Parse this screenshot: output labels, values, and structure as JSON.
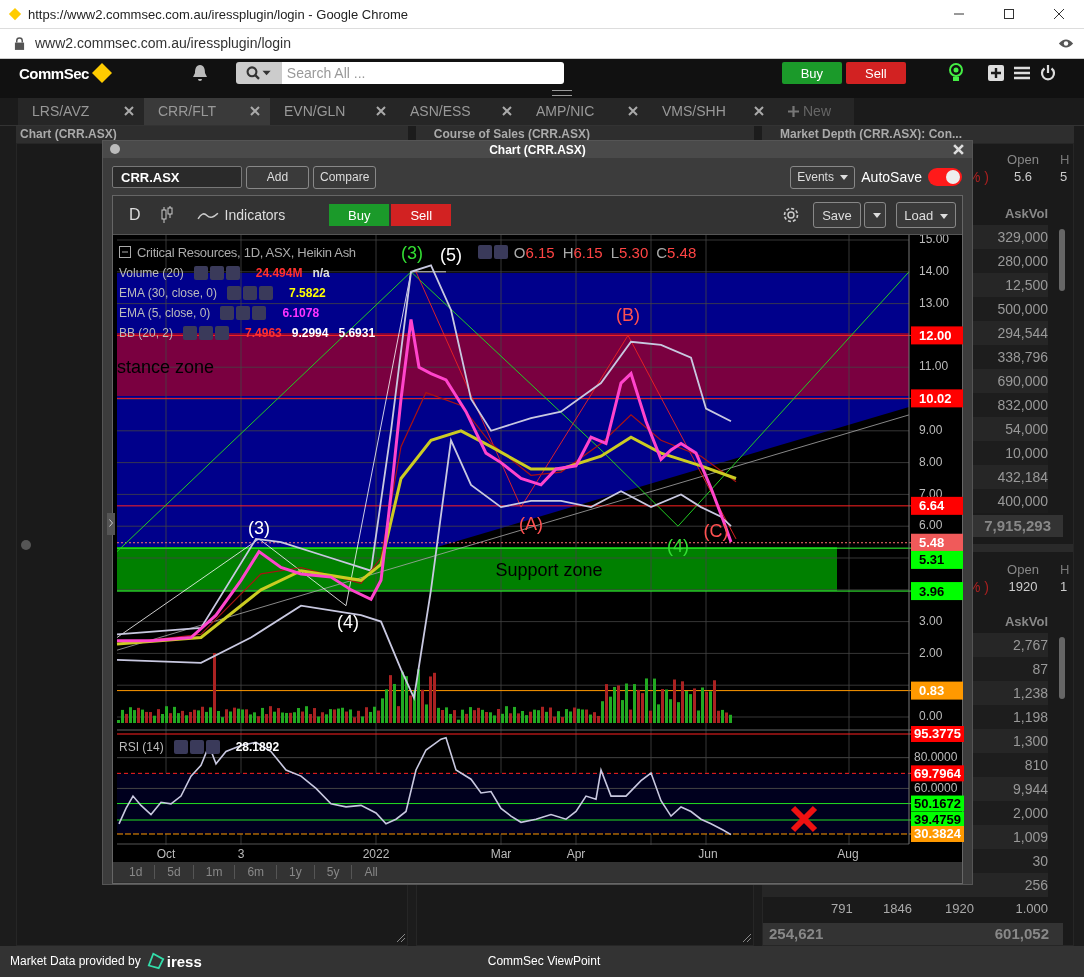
{
  "browser": {
    "title": "https://www2.commsec.com.au/iressplugin/login - Google Chrome",
    "url": "www2.commsec.com.au/iressplugin/login"
  },
  "header": {
    "logo": "CommSec",
    "search_placeholder": "Search All ...",
    "buy": "Buy",
    "sell": "Sell"
  },
  "tabs": [
    {
      "label": "LRS/AVZ",
      "selected": false
    },
    {
      "label": "CRR/FLT",
      "selected": true
    },
    {
      "label": "EVN/GLN",
      "selected": false
    },
    {
      "label": "ASN/ESS",
      "selected": false
    },
    {
      "label": "AMP/NIC",
      "selected": false
    },
    {
      "label": "VMS/SHH",
      "selected": false
    }
  ],
  "new_tab": "New",
  "panels": {
    "chart": "Chart (CRR.ASX)",
    "course_of_sales": "Course of Sales (CRR.ASX)",
    "market_depth": "Market Depth (CRR.ASX): Con..."
  },
  "depth": [
    {
      "open_label": "Open",
      "open": "5.6",
      "h_label": "H",
      "h": "5",
      "change": "% )",
      "ask_vol_label": "AskVol",
      "ask_vols": [
        "329,000",
        "280,000",
        "12,500",
        "500,000",
        "294,544",
        "338,796",
        "690,000",
        "832,000",
        "54,000",
        "10,000",
        "432,184",
        "400,000"
      ],
      "totals": [
        "7,915,293"
      ]
    },
    {
      "open_label": "Open",
      "open": "1920",
      "h_label": "H",
      "h": "1",
      "change": "% )",
      "ask_vol_label": "AskVol",
      "ask_vols": [
        "2,767",
        "87",
        "1,238",
        "1,198",
        "1,300",
        "810",
        "9,944",
        "2,000",
        "1,009",
        "30",
        "256"
      ],
      "footer": [
        "791",
        "1846",
        "1920",
        "1.000"
      ],
      "totals": [
        "254,621",
        "601,052"
      ]
    }
  ],
  "chart_window": {
    "title": "Chart (CRR.ASX)",
    "symbol": "CRR.ASX",
    "add": "Add",
    "compare": "Compare",
    "events": "Events",
    "autosave_label": "AutoSave",
    "autosave_on": true,
    "interval": "D",
    "indicators": "Indicators",
    "buy": "Buy",
    "sell": "Sell",
    "save": "Save",
    "load": "Load",
    "legend": {
      "title": "Critical Resources, 1D, ASX, Heikin Ash",
      "ohlc": [
        {
          "label": "O",
          "value": "6.15"
        },
        {
          "label": "H",
          "value": "6.15"
        },
        {
          "label": "L",
          "value": "5.30"
        },
        {
          "label": "C",
          "value": "5.48"
        }
      ]
    },
    "studies": [
      {
        "name": "Volume (20)",
        "values": [
          {
            "text": "24.494M",
            "color": "#ff3030"
          },
          {
            "text": "n/a",
            "color": "#dddddd"
          }
        ]
      },
      {
        "name": "EMA (30, close, 0)",
        "values": [
          {
            "text": "7.5822",
            "color": "#ffff00"
          }
        ]
      },
      {
        "name": "EMA (5, close, 0)",
        "values": [
          {
            "text": "6.1078",
            "color": "#ff33ff"
          }
        ]
      },
      {
        "name": "BB (20, 2)",
        "values": [
          {
            "text": "7.4963",
            "color": "#ff3030"
          },
          {
            "text": "9.2994",
            "color": "#ffffff"
          },
          {
            "text": "5.6931",
            "color": "#ffffff"
          }
        ]
      }
    ],
    "price_ticks": [
      "15.00",
      "14.00",
      "13.00",
      "11.00",
      "9.00",
      "8.00",
      "7.00",
      "6.00",
      "3.00",
      "2.00",
      "0.00"
    ],
    "price_markers": [
      {
        "label": "12.00",
        "color": "#ff0000"
      },
      {
        "label": "10.02",
        "color": "#ff0000"
      },
      {
        "label": "6.64",
        "color": "#ff0000"
      },
      {
        "label": "5.48",
        "color": "#f05a5a"
      },
      {
        "label": "5.31",
        "color": "#00ff00"
      },
      {
        "label": "3.96",
        "color": "#00ff00"
      },
      {
        "label": "0.83",
        "color": "#ff9900"
      }
    ],
    "annotations": [
      {
        "text": "(3)",
        "color": "#33dd33"
      },
      {
        "text": "(5)",
        "color": "#ffffff"
      },
      {
        "text": "(B)",
        "color": "#ff5050"
      },
      {
        "text": "(A)",
        "color": "#ff5050"
      },
      {
        "text": "(C)",
        "color": "#ff5050"
      },
      {
        "text": "(4)",
        "color": "#33dd33"
      },
      {
        "text": "(3)",
        "color": "#ffffff"
      },
      {
        "text": "(4)",
        "color": "#ffffff"
      },
      {
        "text": "stance zone",
        "color": "#000000"
      },
      {
        "text": "Support zone",
        "color": "#000000"
      }
    ],
    "rsi": {
      "name": "RSI (14)",
      "value": "28.1892",
      "axis": [
        {
          "label": "95.3775",
          "color": "#ff0000"
        },
        {
          "label": "80.0000"
        },
        {
          "label": "69.7964",
          "color": "#ff0000"
        },
        {
          "label": "60.0000"
        },
        {
          "label": "50.1672",
          "color": "#00ff00"
        },
        {
          "label": "39.4759",
          "color": "#00ff00"
        },
        {
          "label": "30.3824",
          "color": "#ff9900"
        }
      ]
    },
    "x_labels": [
      "Oct",
      "3",
      "2022",
      "Mar",
      "Apr",
      "Jun",
      "Aug"
    ],
    "ranges": [
      "1d",
      "5d",
      "1m",
      "6m",
      "1y",
      "5y",
      "All"
    ]
  },
  "footer": {
    "provided_by": "Market Data provided by",
    "provider": "iress",
    "app_name": "CommSec ViewPoint"
  }
}
